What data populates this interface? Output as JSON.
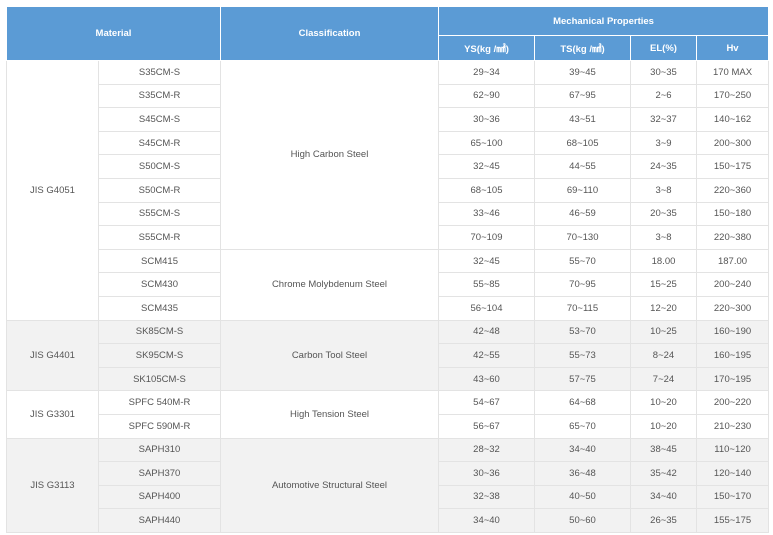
{
  "header": {
    "material": "Material",
    "classification": "Classification",
    "mechanical": "Mechanical Properties",
    "ys": "YS(kg /㎟)",
    "ts": "TS(kg /㎟)",
    "el": "EL(%)",
    "hv": "Hv"
  },
  "groups": [
    {
      "standard": "JIS G4051",
      "shaded": false,
      "classes": [
        {
          "name": "High Carbon Steel",
          "rows": [
            {
              "grade": "S35CM-S",
              "ys": "29~34",
              "ts": "39~45",
              "el": "30~35",
              "hv": "170 MAX"
            },
            {
              "grade": "S35CM-R",
              "ys": "62~90",
              "ts": "67~95",
              "el": "2~6",
              "hv": "170~250"
            },
            {
              "grade": "S45CM-S",
              "ys": "30~36",
              "ts": "43~51",
              "el": "32~37",
              "hv": "140~162"
            },
            {
              "grade": "S45CM-R",
              "ys": "65~100",
              "ts": "68~105",
              "el": "3~9",
              "hv": "200~300"
            },
            {
              "grade": "S50CM-S",
              "ys": "32~45",
              "ts": "44~55",
              "el": "24~35",
              "hv": "150~175"
            },
            {
              "grade": "S50CM-R",
              "ys": "68~105",
              "ts": "69~110",
              "el": "3~8",
              "hv": "220~360"
            },
            {
              "grade": "S55CM-S",
              "ys": "33~46",
              "ts": "46~59",
              "el": "20~35",
              "hv": "150~180"
            },
            {
              "grade": "S55CM-R",
              "ys": "70~109",
              "ts": "70~130",
              "el": "3~8",
              "hv": "220~380"
            }
          ]
        },
        {
          "name": "Chrome Molybdenum Steel",
          "rows": [
            {
              "grade": "SCM415",
              "ys": "32~45",
              "ts": "55~70",
              "el": "18.00",
              "hv": "187.00"
            },
            {
              "grade": "SCM430",
              "ys": "55~85",
              "ts": "70~95",
              "el": "15~25",
              "hv": "200~240"
            },
            {
              "grade": "SCM435",
              "ys": "56~104",
              "ts": "70~115",
              "el": "12~20",
              "hv": "220~300"
            }
          ]
        }
      ]
    },
    {
      "standard": "JIS G4401",
      "shaded": true,
      "classes": [
        {
          "name": "Carbon Tool Steel",
          "rows": [
            {
              "grade": "SK85CM-S",
              "ys": "42~48",
              "ts": "53~70",
              "el": "10~25",
              "hv": "160~190"
            },
            {
              "grade": "SK95CM-S",
              "ys": "42~55",
              "ts": "55~73",
              "el": "8~24",
              "hv": "160~195"
            },
            {
              "grade": "SK105CM-S",
              "ys": "43~60",
              "ts": "57~75",
              "el": "7~24",
              "hv": "170~195"
            }
          ]
        }
      ]
    },
    {
      "standard": "JIS G3301",
      "shaded": false,
      "classes": [
        {
          "name": "High Tension Steel",
          "rows": [
            {
              "grade": "SPFC 540M-R",
              "ys": "54~67",
              "ts": "64~68",
              "el": "10~20",
              "hv": "200~220"
            },
            {
              "grade": "SPFC 590M-R",
              "ys": "56~67",
              "ts": "65~70",
              "el": "10~20",
              "hv": "210~230"
            }
          ]
        }
      ]
    },
    {
      "standard": "JIS G3113",
      "shaded": true,
      "classes": [
        {
          "name": "Automotive Structural Steel",
          "rows": [
            {
              "grade": "SAPH310",
              "ys": "28~32",
              "ts": "34~40",
              "el": "38~45",
              "hv": "110~120"
            },
            {
              "grade": "SAPH370",
              "ys": "30~36",
              "ts": "36~48",
              "el": "35~42",
              "hv": "120~140"
            },
            {
              "grade": "SAPH400",
              "ys": "32~38",
              "ts": "40~50",
              "el": "34~40",
              "hv": "150~170"
            },
            {
              "grade": "SAPH440",
              "ys": "34~40",
              "ts": "50~60",
              "el": "26~35",
              "hv": "155~175"
            }
          ]
        }
      ]
    }
  ]
}
